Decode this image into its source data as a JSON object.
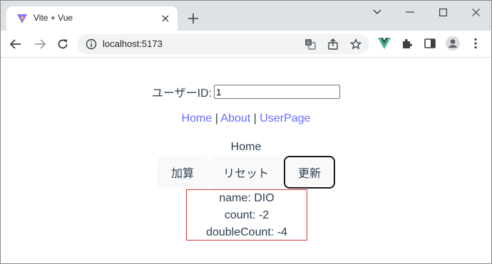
{
  "browser": {
    "tab_title": "Vite + Vue",
    "url": "localhost:5173",
    "accent_color": "#646cff"
  },
  "page": {
    "user_label": "ユーザーID:",
    "user_id_value": "1",
    "nav": {
      "home": "Home",
      "separator": "|",
      "about": "About",
      "userpage": "UserPage"
    },
    "page_name": "Home",
    "buttons": {
      "add": "加算",
      "reset": "リセット",
      "update": "更新"
    },
    "info": {
      "name": "name: DIO",
      "count": "count: -2",
      "double_count": "doubleCount: -4"
    }
  }
}
